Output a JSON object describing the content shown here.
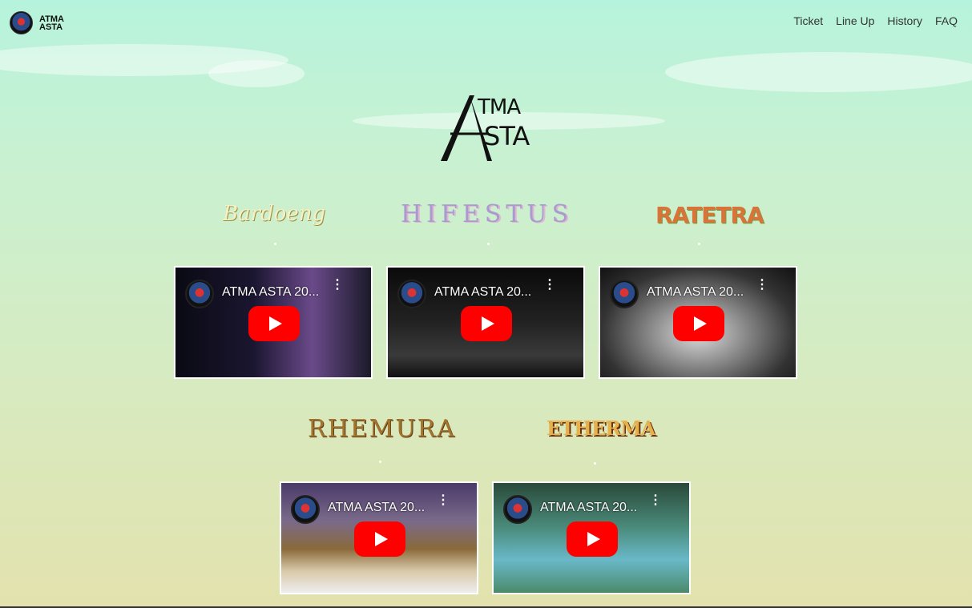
{
  "header": {
    "brand_line1": "ATMA",
    "brand_line2": "ASTA",
    "nav": [
      "Ticket",
      "Line Up",
      "History",
      "FAQ"
    ]
  },
  "hero": {
    "line1": "TMA",
    "line2": "STA"
  },
  "bands": [
    {
      "name": "Bardoeng"
    },
    {
      "name": "HIFESTUS"
    },
    {
      "name": "RATETRA"
    },
    {
      "name": "RHEMURA"
    },
    {
      "name": "ETHERMA"
    }
  ],
  "videos": [
    {
      "title": "ATMA ASTA 20..."
    },
    {
      "title": "ATMA ASTA 20..."
    },
    {
      "title": "ATMA ASTA 20..."
    },
    {
      "title": "ATMA ASTA 20..."
    },
    {
      "title": "ATMA ASTA 20..."
    }
  ]
}
